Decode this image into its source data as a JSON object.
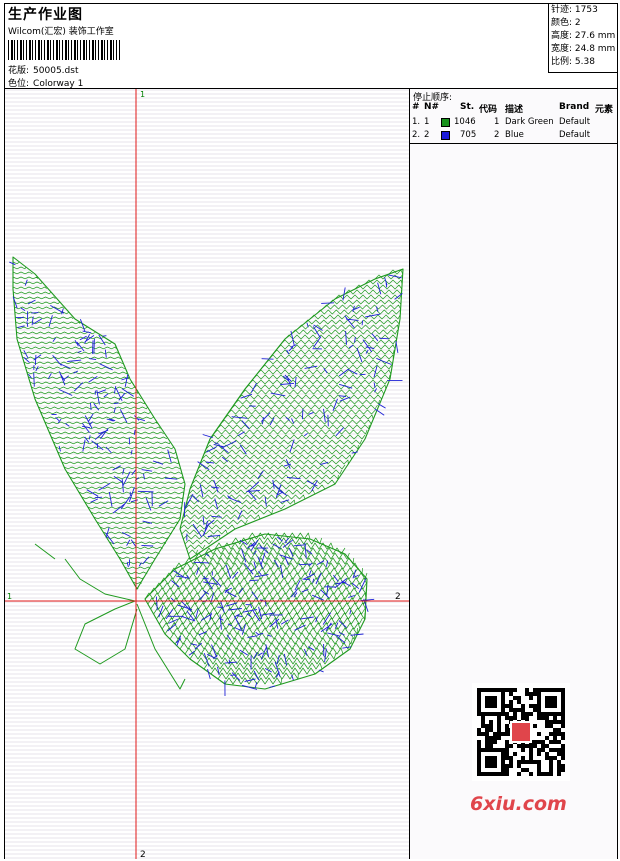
{
  "header": {
    "title": "生产作业图",
    "company": "Wilcom(汇宏) 装饰工作室",
    "design_label": "花版:",
    "design_value": "50005.dst",
    "colorway_label": "色位:",
    "colorway_value": "Colorway 1"
  },
  "stats": {
    "stitches": "针迹: 1753",
    "colors": "颜色: 2",
    "height": "高度: 27.6 mm",
    "width": "宽度: 24.8 mm",
    "scale": "比例: 5.38"
  },
  "axes": {
    "top": "1",
    "left": "1",
    "right": "2",
    "bottom": "2"
  },
  "stop_sequence": {
    "title": "停止顺序:",
    "headers": {
      "hash": "#",
      "n": "N#",
      "st": "St.",
      "code": "代码",
      "desc": "描述",
      "brand": "Brand",
      "elem": "元素"
    },
    "rows": [
      {
        "hash": "1.",
        "n": "1",
        "color": "#17911b",
        "st": "1046",
        "code": "1",
        "desc": "Dark Green",
        "brand": "Default"
      },
      {
        "hash": "2.",
        "n": "2",
        "color": "#1a1ad8",
        "st": "705",
        "code": "2",
        "desc": "Blue",
        "brand": "Default"
      }
    ]
  },
  "colors": {
    "green": "#1f9a1f",
    "blue": "#1f22d6",
    "axis": "#e01818"
  },
  "watermark": "6xiu.com"
}
